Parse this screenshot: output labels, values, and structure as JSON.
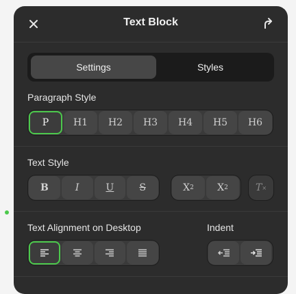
{
  "header": {
    "title": "Text Block",
    "close_icon": "close-icon",
    "action_icon": "curved-arrow-up-icon"
  },
  "tabs": [
    {
      "label": "Settings",
      "active": true
    },
    {
      "label": "Styles",
      "active": false
    }
  ],
  "paragraph_style": {
    "label": "Paragraph Style",
    "options": [
      "P",
      "H1",
      "H2",
      "H3",
      "H4",
      "H5",
      "H6"
    ],
    "selected": "P"
  },
  "text_style": {
    "label": "Text Style",
    "format_buttons": [
      "B",
      "I",
      "U",
      "S"
    ],
    "script_buttons": [
      "X",
      "X"
    ],
    "script_marks": [
      "2",
      "2"
    ],
    "clear_formatting": "T"
  },
  "alignment": {
    "label": "Text Alignment on Desktop",
    "options": [
      "align-left-icon",
      "align-center-icon",
      "align-right-icon",
      "align-justify-icon"
    ],
    "selected": "align-left-icon"
  },
  "indent": {
    "label": "Indent",
    "options": [
      "outdent-icon",
      "indent-icon"
    ]
  },
  "colors": {
    "panel_bg": "#2c2c2c",
    "accent": "#4cc94c",
    "indicator_dot": "#4cc94c"
  }
}
